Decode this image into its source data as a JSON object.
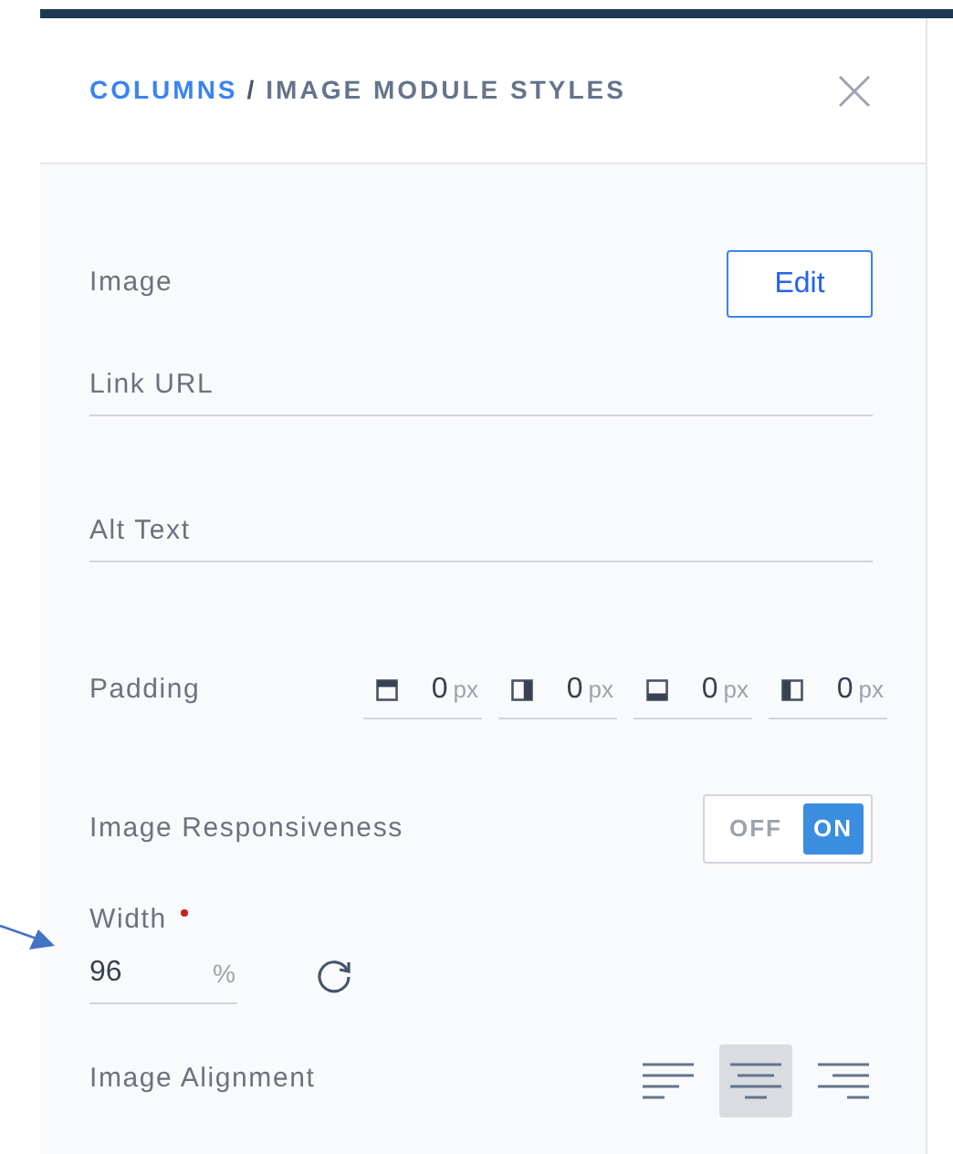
{
  "header": {
    "breadcrumb": "COLUMNS",
    "separator": "/",
    "title": "IMAGE MODULE STYLES"
  },
  "image": {
    "label": "Image",
    "button": "Edit"
  },
  "link_url": {
    "placeholder": "Link URL"
  },
  "alt_text": {
    "placeholder": "Alt Text"
  },
  "padding": {
    "label": "Padding",
    "sides": [
      {
        "kind": "top",
        "value": "0",
        "unit": "px"
      },
      {
        "kind": "right",
        "value": "0",
        "unit": "px"
      },
      {
        "kind": "bottom",
        "value": "0",
        "unit": "px"
      },
      {
        "kind": "left",
        "value": "0",
        "unit": "px"
      }
    ]
  },
  "responsiveness": {
    "label": "Image Responsiveness",
    "off_label": "OFF",
    "on_label": "ON",
    "on": true
  },
  "width": {
    "label": "Width",
    "required": true,
    "value": "96",
    "unit": "%"
  },
  "alignment": {
    "label": "Image Alignment",
    "options": [
      {
        "kind": "left",
        "selected": false
      },
      {
        "kind": "center",
        "selected": true
      },
      {
        "kind": "right",
        "selected": false
      }
    ]
  }
}
